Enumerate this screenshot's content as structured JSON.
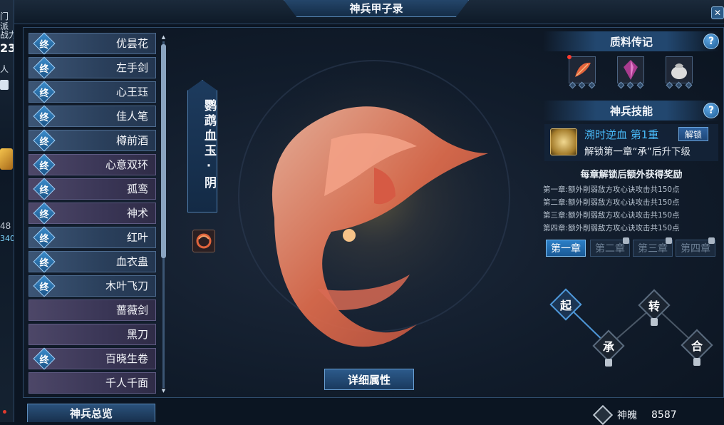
{
  "window": {
    "title": "神兵甲子录",
    "close_label": "✕"
  },
  "left_strip": {
    "fragments": [
      "门",
      "派",
      "战力",
      "23",
      "人",
      "48",
      "340"
    ]
  },
  "weapon_list": [
    {
      "badge": "终",
      "label": "优昙花",
      "style": "blue"
    },
    {
      "badge": "终",
      "label": "左手剑",
      "style": "blue"
    },
    {
      "badge": "终",
      "label": "心王珏",
      "style": "blue"
    },
    {
      "badge": "终",
      "label": "佳人笔",
      "style": "blue"
    },
    {
      "badge": "终",
      "label": "樽前酒",
      "style": "blue"
    },
    {
      "badge": "终",
      "label": "心意双环",
      "style": "purple"
    },
    {
      "badge": "终",
      "label": "孤鸾",
      "style": "purple"
    },
    {
      "badge": "终",
      "label": "神术",
      "style": "purple"
    },
    {
      "badge": "终",
      "label": "红叶",
      "style": "blue"
    },
    {
      "badge": "终",
      "label": "血衣蛊",
      "style": "blue"
    },
    {
      "badge": "终",
      "label": "木叶飞刀",
      "style": "blue"
    },
    {
      "badge": "",
      "label": "蔷薇剑",
      "style": "purple"
    },
    {
      "badge": "",
      "label": "黑刀",
      "style": "purple"
    },
    {
      "badge": "终",
      "label": "百晓生卷",
      "style": "purple"
    },
    {
      "badge": "",
      "label": "千人千面",
      "style": "purple"
    }
  ],
  "selected_weapon": {
    "name": "鹦鹉血玉·阴"
  },
  "detail_button": "详细属性",
  "materials": {
    "title": "质料传记",
    "help": "?",
    "items": [
      "feather-icon",
      "purple-gem-icon",
      "pouch-icon"
    ]
  },
  "skill": {
    "title": "神兵技能",
    "help": "?",
    "name": "溯时逆血 第1重",
    "desc": "解锁第一章“承”后升下级",
    "unlock_label": "解锁"
  },
  "rewards": {
    "title": "每章解锁后额外获得奖励",
    "lines": [
      "第一章:额外削弱敌方攻心诀攻击共150点",
      "第二章:额外削弱敌方攻心诀攻击共150点",
      "第三章:额外削弱敌方攻心诀攻击共150点",
      "第四章:额外削弱敌方攻心诀攻击共150点"
    ]
  },
  "chapters": [
    {
      "label": "第一章",
      "active": true
    },
    {
      "label": "第二章",
      "active": false
    },
    {
      "label": "第三章",
      "active": false
    },
    {
      "label": "第四章",
      "active": false
    }
  ],
  "nodes": [
    {
      "label": "起",
      "active": true
    },
    {
      "label": "承",
      "active": false
    },
    {
      "label": "转",
      "active": false
    },
    {
      "label": "合",
      "active": false
    }
  ],
  "bottom": {
    "tab_label": "神兵总览",
    "currency_name": "神魄",
    "currency_value": "8587"
  },
  "colors": {
    "accent": "#48b8f6",
    "panel": "#111c2b",
    "active_tab": "#2b7fc7"
  }
}
